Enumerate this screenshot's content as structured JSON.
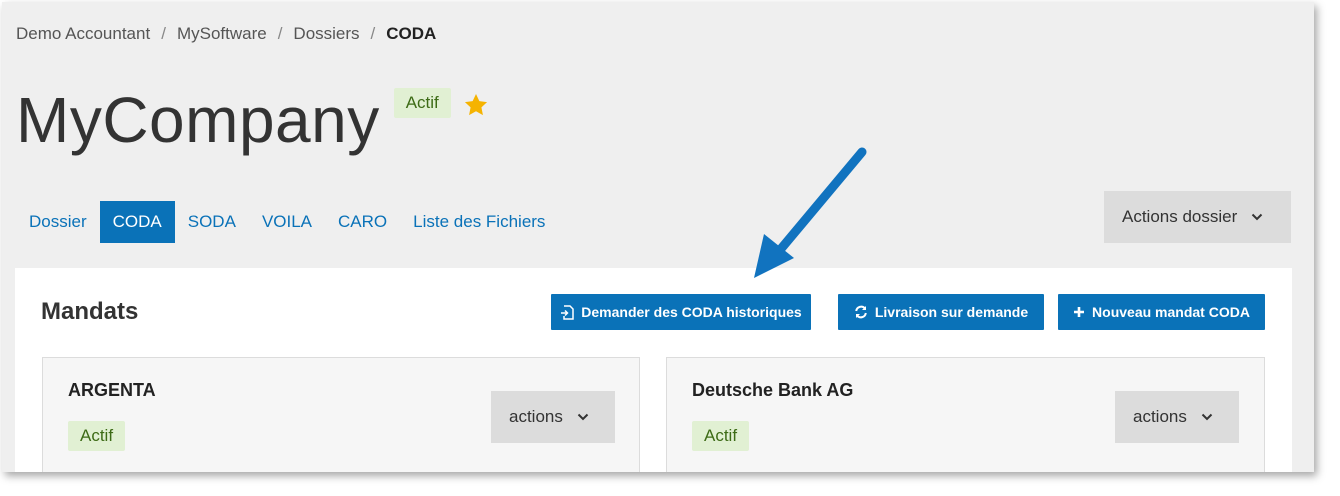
{
  "breadcrumb": {
    "items": [
      "Demo Accountant",
      "MySoftware",
      "Dossiers"
    ],
    "separator": "/",
    "current": "CODA"
  },
  "header": {
    "title": "MyCompany",
    "status": "Actif",
    "favorite_icon": "star-icon"
  },
  "tabs": [
    {
      "label": "Dossier",
      "active": false
    },
    {
      "label": "CODA",
      "active": true
    },
    {
      "label": "SODA",
      "active": false
    },
    {
      "label": "VOILA",
      "active": false
    },
    {
      "label": "CARO",
      "active": false
    },
    {
      "label": "Liste des Fichiers",
      "active": false
    }
  ],
  "dossier_actions": {
    "label": "Actions dossier",
    "icon": "chevron-down-icon"
  },
  "mandats": {
    "title": "Mandats",
    "buttons": {
      "historique": {
        "label": "Demander des CODA historiques",
        "icon": "document-import-icon"
      },
      "livraison": {
        "label": "Livraison sur demande",
        "icon": "refresh-icon"
      },
      "nouveau": {
        "label": "Nouveau mandat CODA",
        "icon": "plus-icon"
      }
    },
    "cards": [
      {
        "bank": "ARGENTA",
        "status": "Actif",
        "actions_label": "actions"
      },
      {
        "bank": "Deutsche Bank AG",
        "status": "Actif",
        "actions_label": "actions"
      }
    ]
  },
  "colors": {
    "primary": "#0a72b8",
    "badge_bg": "#e1f0d3",
    "badge_text": "#3d6b16",
    "star": "#f5b301",
    "arrow": "#1173bf"
  }
}
